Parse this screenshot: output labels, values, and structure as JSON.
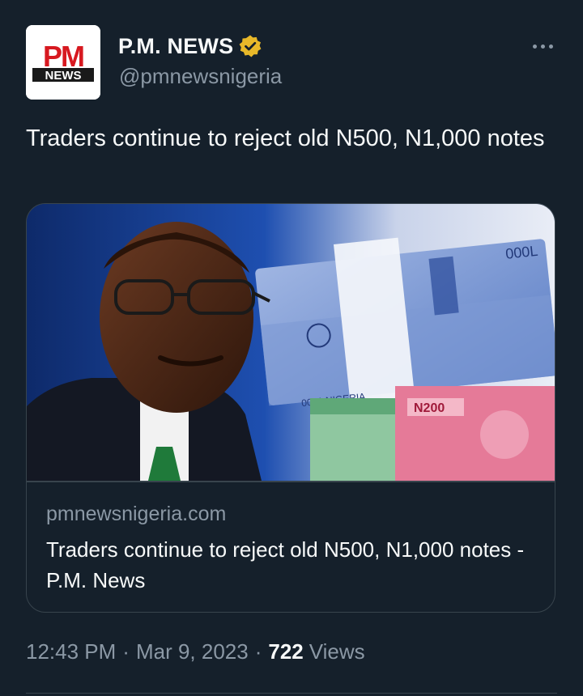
{
  "account": {
    "display_name": "P.M. NEWS",
    "handle": "@pmnewsnigeria",
    "avatar_logo_text_top": "PM",
    "avatar_logo_text_bottom": "NEWS",
    "verified": true
  },
  "tweet": {
    "text": "Traders continue to reject old N500, N1,000 notes"
  },
  "card": {
    "domain": "pmnewsnigeria.com",
    "title": "Traders continue to reject old N500, N1,000 notes - P.M. News",
    "image_description_icon": "news-photo"
  },
  "meta": {
    "time": "12:43 PM",
    "separator": "·",
    "date": "Mar 9, 2023",
    "views_count": "722",
    "views_label": "Views"
  },
  "colors": {
    "background": "#15202b",
    "primary_text": "#f7f9f9",
    "secondary_text": "#8b98a5",
    "border": "#38444d",
    "verified_gold": "#e8b829",
    "logo_red": "#d71920"
  }
}
